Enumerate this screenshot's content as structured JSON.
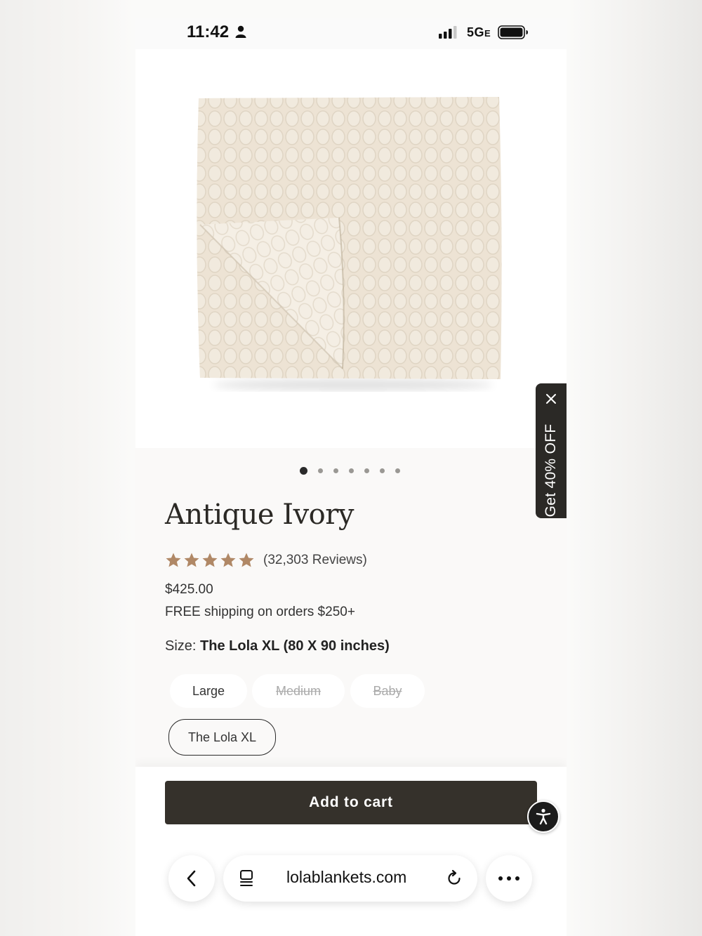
{
  "status_bar": {
    "time": "11:42",
    "network": "5G",
    "network_suffix": "E"
  },
  "product": {
    "title": "Antique Ivory",
    "rating_stars": 5,
    "reviews": "(32,303 Reviews)",
    "price": "$425.00",
    "shipping": "FREE shipping on orders $250+",
    "size_label": "Size:",
    "size_value": "The Lola XL (80 X 90 inches)",
    "image_count": 7,
    "active_image_index": 0
  },
  "sizes": [
    {
      "label": "Large",
      "state": "available"
    },
    {
      "label": "Medium",
      "state": "unavailable"
    },
    {
      "label": "Baby",
      "state": "unavailable"
    },
    {
      "label": "The Lola XL",
      "state": "selected"
    }
  ],
  "cart": {
    "add_label": "Add to cart"
  },
  "promo": {
    "label": "Get 40% OFF"
  },
  "browser": {
    "url": "lolablankets.com"
  },
  "colors": {
    "accent_dark": "#35312b",
    "star": "#b08866",
    "blanket": "#ede3d4"
  }
}
